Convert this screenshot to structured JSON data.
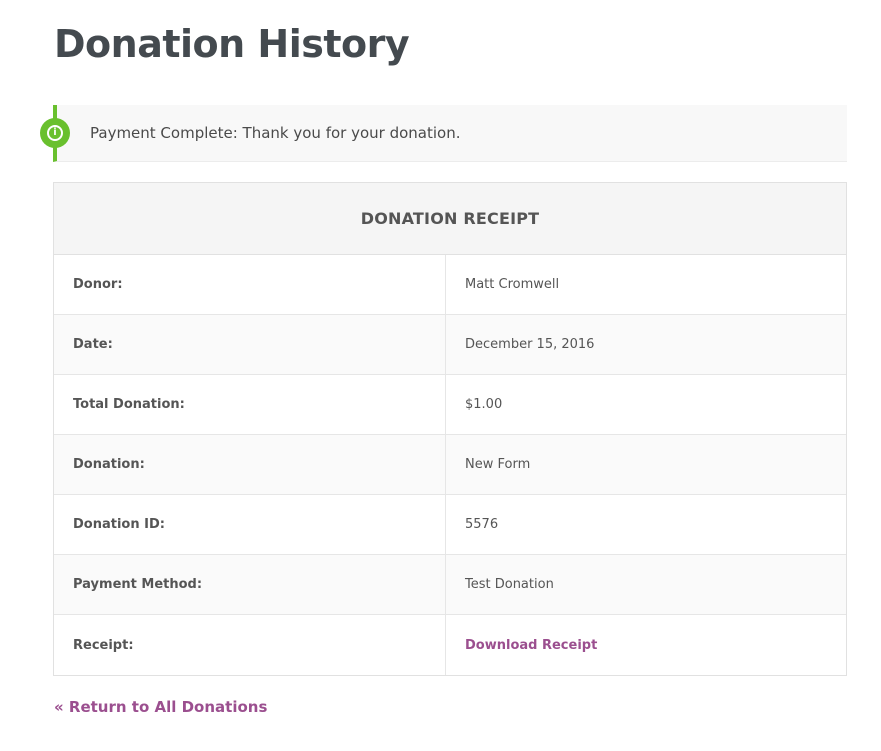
{
  "page": {
    "title": "Donation History"
  },
  "notice": {
    "icon": "info-icon",
    "icon_glyph": "i",
    "text": "Payment Complete: Thank you for your donation.",
    "accent_color": "#69c02e"
  },
  "receipt": {
    "heading": "DONATION RECEIPT",
    "rows": [
      {
        "label": "Donor:",
        "value": "Matt Cromwell"
      },
      {
        "label": "Date:",
        "value": "December 15, 2016"
      },
      {
        "label": "Total Donation:",
        "value": "$1.00"
      },
      {
        "label": "Donation:",
        "value": "New Form"
      },
      {
        "label": "Donation ID:",
        "value": "5576"
      },
      {
        "label": "Payment Method:",
        "value": "Test Donation"
      },
      {
        "label": "Receipt:",
        "value": "Download Receipt"
      }
    ]
  },
  "links": {
    "return_label": "« Return to All Donations",
    "link_color": "#9b4f8f"
  }
}
